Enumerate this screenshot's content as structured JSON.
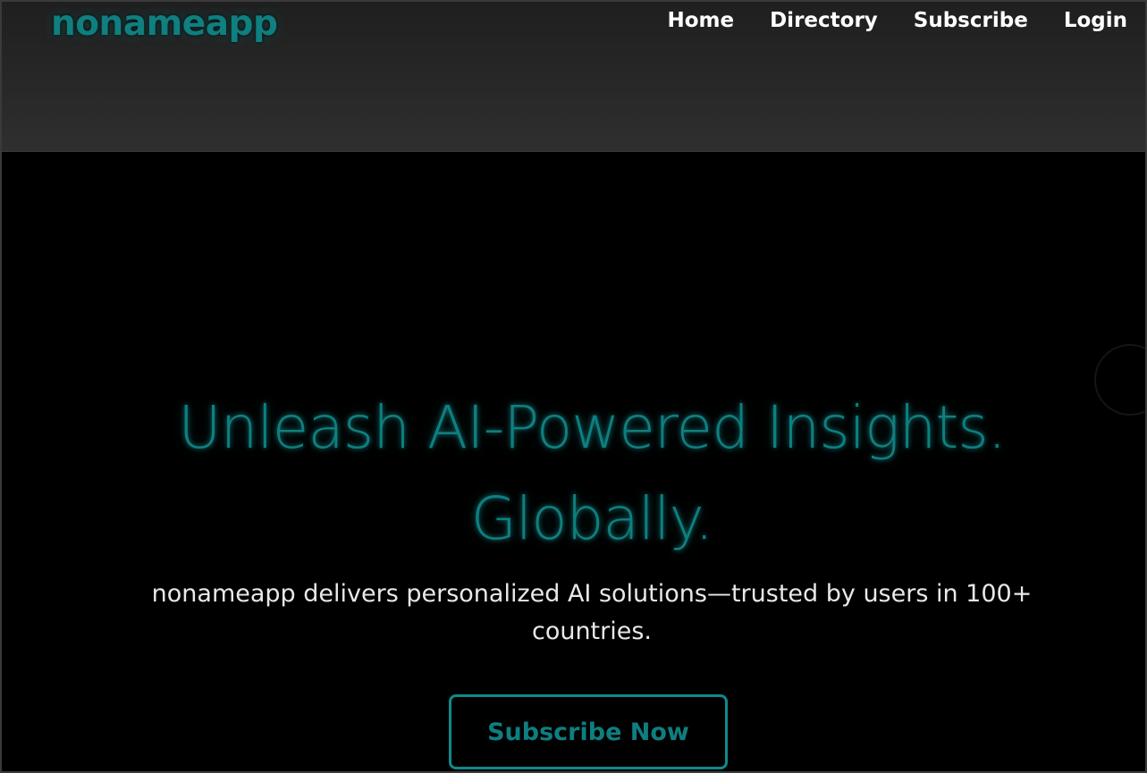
{
  "header": {
    "logo": "nonameapp",
    "nav": [
      {
        "label": "Home"
      },
      {
        "label": "Directory"
      },
      {
        "label": "Subscribe"
      },
      {
        "label": "Login"
      }
    ]
  },
  "hero": {
    "title": "Unleash AI-Powered Insights. Globally.",
    "subtitle": "nonameapp delivers personalized AI solutions—trusted by users in 100+ countries.",
    "cta_label": "Subscribe Now"
  },
  "colors": {
    "accent": "#0e7f80",
    "header_bg": "#262626",
    "page_bg": "#000000",
    "text": "#ffffff"
  }
}
